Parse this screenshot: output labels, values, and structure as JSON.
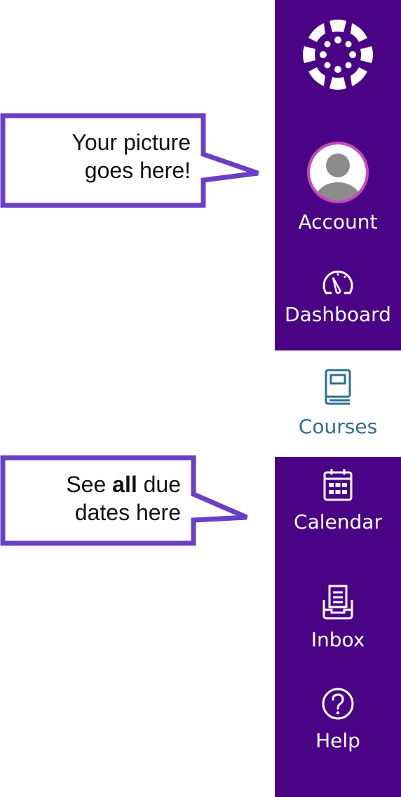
{
  "nav": {
    "logo_icon": "canvas-logo-icon",
    "items": [
      {
        "label": "Account",
        "icon": "avatar-icon"
      },
      {
        "label": "Dashboard",
        "icon": "dashboard-gauge-icon"
      },
      {
        "label": "Courses",
        "icon": "book-icon",
        "active": true
      },
      {
        "label": "Calendar",
        "icon": "calendar-icon"
      },
      {
        "label": "Inbox",
        "icon": "inbox-tray-icon"
      },
      {
        "label": "Help",
        "icon": "question-circle-icon"
      }
    ]
  },
  "callouts": {
    "picture": {
      "line1": "Your picture",
      "line2": "goes here!"
    },
    "due_dates": {
      "prefix": "See ",
      "bold": "all",
      "suffix": " due",
      "line2": "dates here"
    }
  },
  "colors": {
    "nav_background": "#4a0384",
    "nav_text": "#ffffff",
    "active_text": "#2f6f8f",
    "callout_border": "#6b3fc4",
    "avatar_ring": "#c14bb8"
  }
}
